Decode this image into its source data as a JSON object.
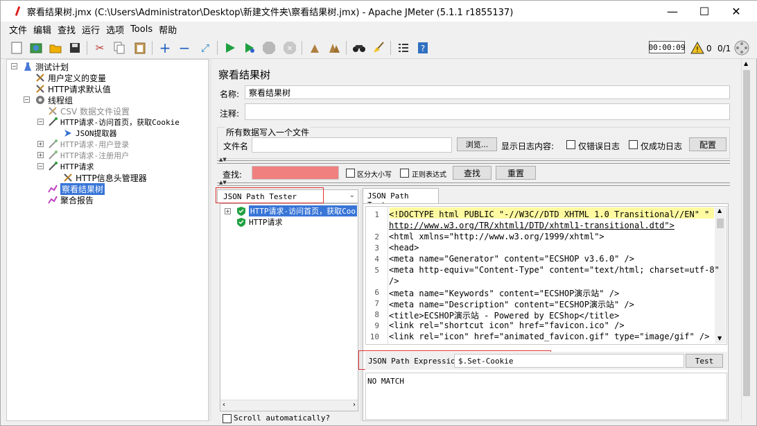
{
  "window": {
    "title": "察看结果树.jmx (C:\\Users\\Administrator\\Desktop\\新建文件夹\\察看结果树.jmx) - Apache JMeter (5.1.1 r1855137)",
    "minimize": "—",
    "maximize": "☐",
    "close": "✕"
  },
  "menu": [
    "文件",
    "编辑",
    "查找",
    "运行",
    "选项",
    "Tools",
    "帮助"
  ],
  "status": {
    "timer": "00:00:09",
    "warnings": "0",
    "threads": "0/1"
  },
  "tree": {
    "items": [
      {
        "label": "测试计划",
        "icon": "flask-icon",
        "disabled": false
      },
      {
        "label": "用户定义的变量",
        "icon": "wrench-icon",
        "disabled": false
      },
      {
        "label": "HTTP请求默认值",
        "icon": "wrench-icon",
        "disabled": false
      },
      {
        "label": "线程组",
        "icon": "gear-icon",
        "disabled": false
      },
      {
        "label": "CSV 数据文件设置",
        "icon": "wrench-icon",
        "disabled": true
      },
      {
        "label": "HTTP请求-访问首页，获取Cookie",
        "icon": "pipette-icon",
        "disabled": false
      },
      {
        "label": "JSON提取器",
        "icon": "arrow-icon",
        "disabled": false
      },
      {
        "label": "HTTP请求-用户登录",
        "icon": "pipette-icon",
        "disabled": true
      },
      {
        "label": "HTTP请求-注册用户",
        "icon": "pipette-icon",
        "disabled": true
      },
      {
        "label": "HTTP请求",
        "icon": "pipette-icon",
        "disabled": false
      },
      {
        "label": "HTTP信息头管理器",
        "icon": "wrench-icon",
        "disabled": false
      },
      {
        "label": "察看结果树",
        "icon": "chart-icon",
        "disabled": false,
        "selected": true
      },
      {
        "label": "聚合报告",
        "icon": "chart-icon",
        "disabled": false
      }
    ]
  },
  "panel": {
    "title": "察看结果树",
    "name_label": "名称:",
    "name_value": "察看结果树",
    "comment_label": "注释:",
    "comment_value": "",
    "file_section": "所有数据写入一个文件",
    "filename_label": "文件名",
    "browse_button": "浏览...",
    "log_label": "显示日志内容:",
    "errors_only": "仅错误日志",
    "success_only": "仅成功日志",
    "configure_button": "配置",
    "search_label": "查找:",
    "case_sensitive": "区分大小写",
    "regex": "正则表达式",
    "find_button": "查找",
    "reset_button": "重置"
  },
  "results": {
    "renderer": "JSON Path Tester",
    "samples": [
      {
        "label": "HTTP请求-访问首页，获取Coo",
        "selected": true,
        "expandable": true
      },
      {
        "label": "HTTP请求",
        "selected": false,
        "expandable": false
      }
    ],
    "scroll_auto": "Scroll automatically?",
    "tab": "JSON Path Tester",
    "code_lines": [
      {
        "n": "1",
        "text": "<!DOCTYPE html PUBLIC \"-//W3C//DTD XHTML 1.0 Transitional//EN\" \""
      },
      {
        "n": "",
        "text": "http://www.w3.org/TR/xhtml1/DTD/xhtml1-transitional.dtd\">"
      },
      {
        "n": "2",
        "text": "<html xmlns=\"http://www.w3.org/1999/xhtml\">"
      },
      {
        "n": "3",
        "text": "<head>"
      },
      {
        "n": "4",
        "text": "<meta name=\"Generator\" content=\"ECSHOP v3.6.0\" />"
      },
      {
        "n": "5",
        "text": "<meta http-equiv=\"Content-Type\" content=\"text/html; charset=utf-8\""
      },
      {
        "n": "",
        "text": "/>"
      },
      {
        "n": "6",
        "text": "<meta name=\"Keywords\" content=\"ECSHOP演示站\" />"
      },
      {
        "n": "7",
        "text": "<meta name=\"Description\" content=\"ECSHOP演示站\" />"
      },
      {
        "n": "8",
        "text": "<title>ECSHOP演示站 - Powered by ECShop</title>"
      },
      {
        "n": "9",
        "text": "<link rel=\"shortcut icon\" href=\"favicon.ico\" />"
      },
      {
        "n": "10",
        "text": "<link rel=\"icon\" href=\"animated_favicon.gif\" type=\"image/gif\" />"
      }
    ],
    "expression_label": "JSON Path Expression",
    "expression_value": "$.Set-Cookie",
    "test_button": "Test",
    "result_text": "NO MATCH"
  }
}
